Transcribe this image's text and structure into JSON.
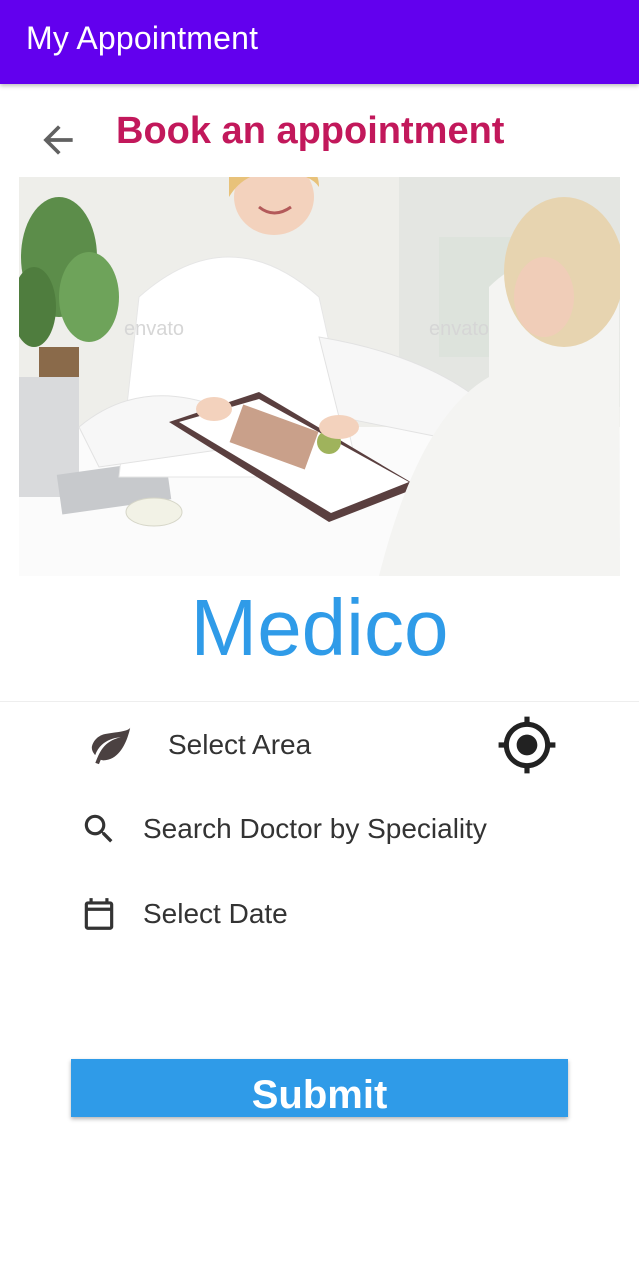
{
  "app_bar": {
    "title": "My Appointment"
  },
  "header": {
    "back_icon": "arrow-left-icon",
    "title": "Book an appointment"
  },
  "hero_image": {
    "watermark": "envato"
  },
  "brand": {
    "name": "Medico"
  },
  "form": {
    "area": {
      "icon": "leaf-icon",
      "label": "Select Area",
      "action_icon": "my-location-icon"
    },
    "speciality": {
      "icon": "search-icon",
      "label": "Search Doctor by Speciality"
    },
    "date": {
      "icon": "calendar-icon",
      "label": "Select Date"
    }
  },
  "submit": {
    "label": "Submit"
  },
  "colors": {
    "app_bar": "#6200ee",
    "title_accent": "#c2185b",
    "brand_blue": "#2f9be8"
  }
}
